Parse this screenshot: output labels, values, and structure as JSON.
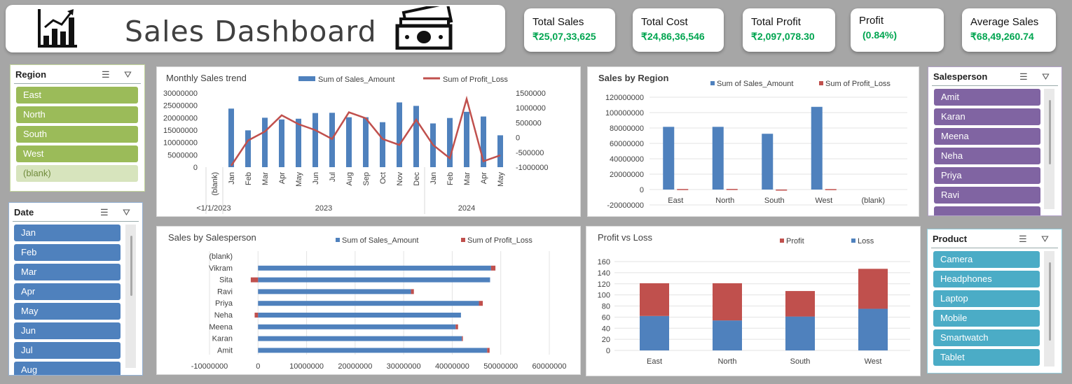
{
  "header": {
    "title": "Sales Dashboard"
  },
  "kpis": {
    "total_sales": {
      "label": "Total Sales",
      "value": "₹25,07,33,625"
    },
    "total_cost": {
      "label": "Total Cost",
      "value": "₹24,86,36,546"
    },
    "total_profit": {
      "label": "Total Profit",
      "value": "₹2,097,078.30"
    },
    "profit_pct": {
      "label": "Profit",
      "value": "(0.84%)"
    },
    "average_sales": {
      "label": "Average Sales",
      "value": "₹68,49,260.74"
    }
  },
  "slicers": {
    "region": {
      "title": "Region",
      "items": [
        "East",
        "North",
        "South",
        "West",
        "(blank)"
      ],
      "color": "#9bbb59",
      "blank_color": "#d7e4bd"
    },
    "date": {
      "title": "Date",
      "items": [
        "Jan",
        "Feb",
        "Mar",
        "Apr",
        "May",
        "Jun",
        "Jul",
        "Aug"
      ],
      "color": "#4f81bd"
    },
    "salesperson": {
      "title": "Salesperson",
      "items": [
        "Amit",
        "Karan",
        "Meena",
        "Neha",
        "Priya",
        "Ravi"
      ],
      "color": "#8064a2"
    },
    "product": {
      "title": "Product",
      "items": [
        "Camera",
        "Headphones",
        "Laptop",
        "Mobile",
        "Smartwatch",
        "Tablet"
      ],
      "color": "#4bacc6"
    }
  },
  "chart_data": [
    {
      "type": "bar",
      "title": "Monthly Sales trend",
      "legend": [
        "Sum of Sales_Amount",
        "Sum of Profit_Loss"
      ],
      "legend_position": "top",
      "categories": [
        "(blank)",
        "Jan",
        "Feb",
        "Mar",
        "Apr",
        "May",
        "Jun",
        "Jul",
        "Aug",
        "Sep",
        "Oct",
        "Nov",
        "Dec",
        "Jan",
        "Feb",
        "Mar",
        "Apr",
        "May"
      ],
      "groups": [
        {
          "label": "<1/1/2023",
          "span": 1
        },
        {
          "label": "2023",
          "span": 12
        },
        {
          "label": "2024",
          "span": 5
        }
      ],
      "series": [
        {
          "name": "Sum of Sales_Amount",
          "kind": "column",
          "axis": "primary",
          "values": [
            null,
            23700000,
            14900000,
            20000000,
            19300000,
            19600000,
            21900000,
            22000000,
            20200000,
            20200000,
            18200000,
            26200000,
            24800000,
            17700000,
            19900000,
            22400000,
            20500000,
            12900000
          ]
        },
        {
          "name": "Sum of Profit_Loss",
          "kind": "line",
          "axis": "secondary",
          "values": [
            null,
            -950000,
            -100000,
            200000,
            750000,
            450000,
            250000,
            -50000,
            850000,
            650000,
            -50000,
            -250000,
            600000,
            -250000,
            -700000,
            1300000,
            -800000,
            -600000
          ]
        }
      ],
      "ylim": [
        0,
        30000000
      ],
      "y_ticks": [
        "30000000",
        "25000000",
        "20000000",
        "15000000",
        "10000000",
        "5000000",
        "0"
      ],
      "y2lim": [
        -1000000,
        1500000
      ],
      "y2_ticks": [
        "1500000",
        "1000000",
        "500000",
        "0",
        "-500000",
        "-1000000"
      ]
    },
    {
      "type": "bar",
      "title": "Sales by Region",
      "legend": [
        "Sum of Sales_Amount",
        "Sum of Profit_Loss"
      ],
      "legend_position": "top",
      "categories": [
        "East",
        "North",
        "South",
        "West",
        "(blank)"
      ],
      "series": [
        {
          "name": "Sum of Sales_Amount",
          "values": [
            81500000,
            81500000,
            72500000,
            107500000,
            null
          ]
        },
        {
          "name": "Sum of Profit_Loss",
          "values": [
            700000,
            800000,
            -100000,
            600000,
            null
          ]
        }
      ],
      "ylim": [
        -20000000,
        120000000
      ],
      "y_ticks": [
        "120000000",
        "100000000",
        "80000000",
        "60000000",
        "40000000",
        "20000000",
        "0",
        "-20000000"
      ],
      "grid": true
    },
    {
      "type": "bar",
      "orientation": "horizontal",
      "title": "Sales by Salesperson",
      "legend": [
        "Sum of Sales_Amount",
        "Sum of Profit_Loss"
      ],
      "legend_position": "top",
      "categories": [
        "(blank)",
        "Vikram",
        "Sita",
        "Ravi",
        "Priya",
        "Neha",
        "Meena",
        "Karan",
        "Amit"
      ],
      "series": [
        {
          "name": "Sum of Sales_Amount",
          "values": [
            null,
            48000000,
            47800000,
            31500000,
            45500000,
            41800000,
            40700000,
            42000000,
            47200000
          ]
        },
        {
          "name": "Sum of Profit_Loss",
          "values": [
            null,
            900000,
            -1500000,
            600000,
            800000,
            -700000,
            500000,
            200000,
            500000
          ]
        }
      ],
      "xlim": [
        -10000000,
        60000000
      ],
      "x_ticks": [
        "-10000000",
        "0",
        "10000000",
        "20000000",
        "30000000",
        "40000000",
        "50000000",
        "60000000"
      ],
      "grid": true
    },
    {
      "type": "bar",
      "stacked": true,
      "title": "Profit vs Loss",
      "legend": [
        "Profit",
        "Loss"
      ],
      "legend_position": "top",
      "categories": [
        "East",
        "North",
        "South",
        "West"
      ],
      "series": [
        {
          "name": "Loss",
          "values": [
            62,
            54,
            61,
            75
          ]
        },
        {
          "name": "Profit",
          "values": [
            59,
            67,
            46,
            72
          ]
        }
      ],
      "ylim": [
        0,
        160
      ],
      "y_ticks": [
        "160",
        "140",
        "120",
        "100",
        "80",
        "60",
        "40",
        "20",
        "0"
      ],
      "grid": true
    }
  ],
  "colors": {
    "blue": "#4f81bd",
    "red": "#c0504d",
    "kpi_green": "#00a550"
  }
}
